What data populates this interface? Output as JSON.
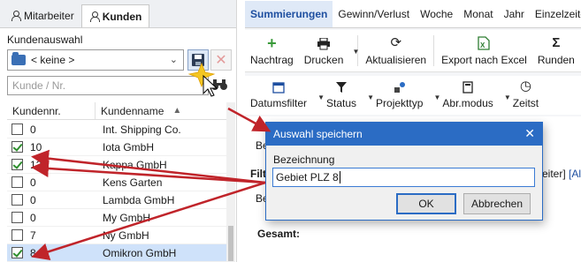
{
  "left": {
    "tabs": [
      {
        "label": "Mitarbeiter"
      },
      {
        "label": "Kunden"
      }
    ],
    "selection_label": "Kundenauswahl",
    "selection_value": "< keine >",
    "search_placeholder": "Kunde / Nr.",
    "columns": [
      "Kundennr.",
      "Kundenname"
    ],
    "rows": [
      {
        "nr": "0",
        "name": "Int. Shipping Co.",
        "checked": false
      },
      {
        "nr": "10",
        "name": "Iota GmbH",
        "checked": true
      },
      {
        "nr": "12",
        "name": "Kappa GmbH",
        "checked": true
      },
      {
        "nr": "0",
        "name": "Kens Garten",
        "checked": false
      },
      {
        "nr": "0",
        "name": "Lambda GmbH",
        "checked": false
      },
      {
        "nr": "0",
        "name": "My GmbH",
        "checked": false
      },
      {
        "nr": "7",
        "name": "Ny GmbH",
        "checked": false
      },
      {
        "nr": "8",
        "name": "Omikron GmbH",
        "checked": true
      }
    ]
  },
  "right": {
    "tabs": [
      "Summierungen",
      "Gewinn/Verlust",
      "Woche",
      "Monat",
      "Jahr",
      "Einzelzeiten"
    ],
    "toolbar1": [
      {
        "label": "Nachtrag",
        "icon": "plus-icon"
      },
      {
        "label": "Drucken",
        "icon": "printer-icon"
      },
      {
        "label": "Aktualisieren",
        "icon": "refresh-icon"
      },
      {
        "label": "Export nach Excel",
        "icon": "excel-icon"
      },
      {
        "label": "Runden",
        "icon": "sigma-icon"
      }
    ],
    "toolbar2": [
      {
        "label": "Datumsfilter",
        "icon": "calendar-icon"
      },
      {
        "label": "Status",
        "icon": "filter-icon"
      },
      {
        "label": "Projekttyp",
        "icon": "shapes-icon"
      },
      {
        "label": "Abr.modus",
        "icon": "calculator-icon"
      },
      {
        "label": "Zeitst",
        "icon": "clock-icon"
      }
    ],
    "fragments": {
      "be1": "Be",
      "filt": "Filt",
      "eiter": "eiter]",
      "all": "[All",
      "be2": "Be",
      "gesamt": "Gesamt:"
    }
  },
  "dialog": {
    "title": "Auswahl speichern",
    "field_label": "Bezeichnung",
    "field_value": "Gebiet PLZ 8",
    "ok_label": "OK",
    "cancel_label": "Abbrechen"
  },
  "colors": {
    "accent": "#2b6cc4",
    "arrow": "#c0242a",
    "selected_row": "#cfe2fa"
  }
}
